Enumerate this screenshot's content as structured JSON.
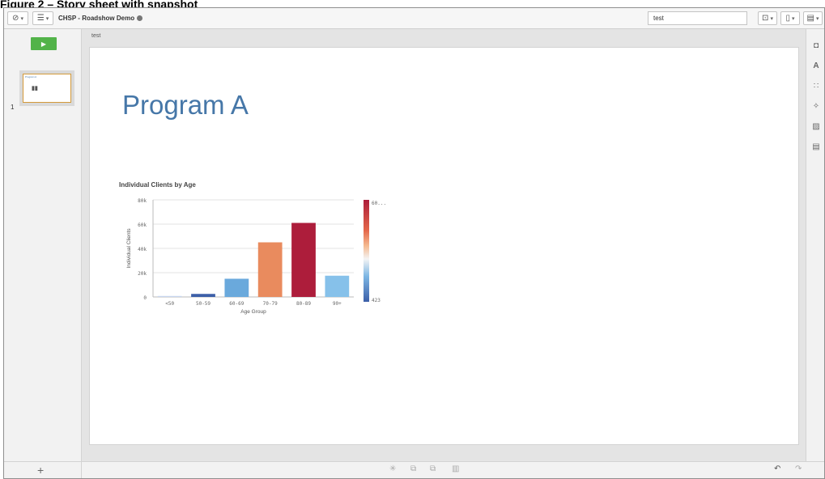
{
  "caption": "Figure 2 – Story sheet with snapshot",
  "toolbar": {
    "nav_icon": "compass-icon",
    "list_icon": "list-icon",
    "app_title": "CHSP - Roadshow Demo",
    "search_value": "test"
  },
  "left_panel": {
    "play_label": "▶",
    "slide_number": "1",
    "thumb_title": "Program A",
    "add_label": "+"
  },
  "story": {
    "name": "test",
    "title": "Program A"
  },
  "chart_data": {
    "type": "bar",
    "title": "Individual Clients by Age",
    "xlabel": "Age Group",
    "ylabel": "Individual Clients",
    "categories": [
      "<50",
      "50-59",
      "60-69",
      "70-79",
      "80-89",
      "90+"
    ],
    "values": [
      800,
      2500,
      15000,
      45000,
      61000,
      17500
    ],
    "bar_colors": [
      "#c8d6ee",
      "#3c5fa8",
      "#6aa9dc",
      "#e98b5e",
      "#ad1d3b",
      "#86c1ea"
    ],
    "yticks": [
      "0",
      "20k",
      "40k",
      "60k",
      "80k"
    ],
    "ylim": [
      0,
      80000
    ],
    "grid": true,
    "legend": {
      "type": "color-gradient",
      "max_label": "60...",
      "min_label": "423",
      "placement": "right"
    }
  },
  "colors": {
    "accent": "#4677a8",
    "play": "#52b349"
  }
}
